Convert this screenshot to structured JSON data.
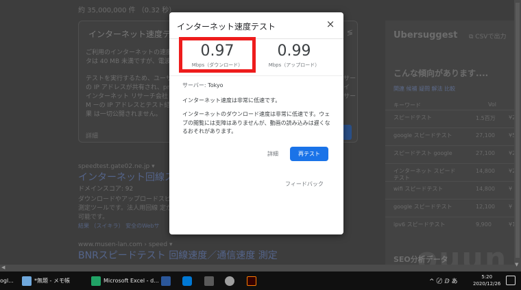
{
  "background": {
    "results_count": "約 35,000,000 件 （0.32 秒）",
    "card": {
      "title": "インターネット速度テスト",
      "para1": "ご利用のインターネットの速度 タは 40 MB 未満ですが、電波",
      "para2": "テストを実行するため、ユーザ の IP アドレスが共有され、pr インターネット リサーチ会社 M ーの IP アドレスとテスト結果 は一切公開されません。",
      "para_right": "サー イ サー",
      "more": "詳細"
    },
    "result1": {
      "url": "speedtest.gate02.ne.jp ▾",
      "title": "インターネット回線スピ",
      "domain_score": "ドメインスコア: 92",
      "desc": "ダウンロードやアップロードスピ 測定ツールです。法人用回線 定が可能です。",
      "links": "結果 （スイキラ） 安全のWebサ"
    },
    "result2": {
      "url": "www.musen-lan.com › speed ▾",
      "title": "BNRスピードテスト 回線速度／通信速度 測定"
    },
    "sidebar": {
      "brand": "Ubersuggest",
      "csv": "CSVで出力",
      "trend": "こんな傾向があります....",
      "tabs": "関連 候補 疑問 解法 比較",
      "col_keyword": "キーワード",
      "col_vol": "Vol",
      "rows": [
        {
          "kw": "スピードテスト",
          "vol": "1.5百万",
          "cpc": "¥2"
        },
        {
          "kw": "google スピードテスト",
          "vol": "27,100",
          "cpc": "¥5"
        },
        {
          "kw": "スピードテスト google",
          "vol": "27,100",
          "cpc": "¥2"
        },
        {
          "kw": "インターネット スピード テスト",
          "vol": "14,800",
          "cpc": "¥2"
        },
        {
          "kw": "wifi スピードテスト",
          "vol": "14,800",
          "cpc": "¥"
        },
        {
          "kw": "google スピードテスト",
          "vol": "12,100",
          "cpc": "¥"
        },
        {
          "kw": "ipv6 スピードテスト",
          "vol": "9,900",
          "cpc": "¥1"
        }
      ],
      "seo": "SEO分析データ"
    },
    "watermark": "ouun"
  },
  "dialog": {
    "title": "インターネット速度テスト",
    "close": "×",
    "download_value": "0.97",
    "download_unit": "Mbps（ダウンロード）",
    "upload_value": "0.99",
    "upload_unit": "Mbps（アップロード）",
    "server_label": "サーバー:",
    "server_city": "Tokyo",
    "message_short": "インターネット速度は非常に低速です。",
    "message_long": "インターネットのダウンロード速度は非常に低速です。ウェブの閲覧には支障はありませんが、動画の読み込みは遅くなるおそれがあります。",
    "detail_link": "詳細",
    "retest_button": "再テスト",
    "feedback_link": "フィードバック"
  },
  "taskbar": {
    "items": [
      "ogl...",
      "*無題 - メモ帳",
      "Microsoft Excel - d..."
    ],
    "tray": "^ 〄 ⅅ あ",
    "time": "5:20",
    "date": "2020/12/26"
  },
  "colors": {
    "highlight": "#ee1c1c",
    "retest_button": "#1a73e8",
    "overlay": "#3d3d3d"
  }
}
